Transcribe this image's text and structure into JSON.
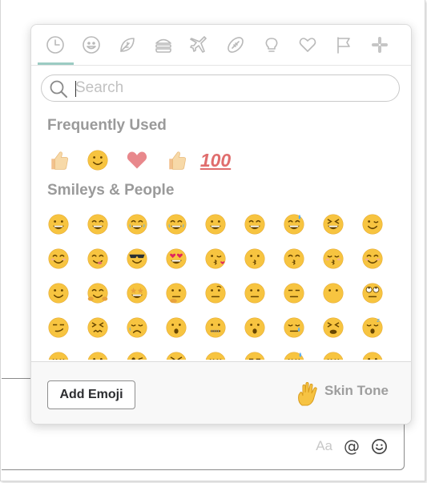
{
  "categories": [
    {
      "name": "recent-icon",
      "active": true
    },
    {
      "name": "smileys-icon"
    },
    {
      "name": "nature-icon"
    },
    {
      "name": "food-icon"
    },
    {
      "name": "travel-icon"
    },
    {
      "name": "activity-icon"
    },
    {
      "name": "objects-icon"
    },
    {
      "name": "symbols-icon"
    },
    {
      "name": "flags-icon"
    },
    {
      "name": "slack-icon"
    }
  ],
  "search": {
    "placeholder": "Search",
    "value": ""
  },
  "frequently_used": {
    "title": "Frequently Used",
    "items": [
      "thumbsup-light",
      "slight-smile",
      "heart",
      "thumbsup-light",
      "100"
    ],
    "hundred_text": "100"
  },
  "smileys": {
    "title": "Smileys & People",
    "rows": [
      [
        "grinning",
        "grin",
        "joy",
        "rofl",
        "smiley",
        "smile",
        "sweat-smile",
        "laughing",
        "wink"
      ],
      [
        "blush",
        "yum",
        "sunglasses",
        "heart-eyes",
        "kissing-heart",
        "kissing",
        "kissing-smiling",
        "kissing-closed",
        "relaxed"
      ],
      [
        "slight-smile",
        "hugging",
        "star-struck",
        "thinking",
        "raised-eyebrow",
        "neutral",
        "expressionless",
        "no-mouth",
        "eye-roll"
      ],
      [
        "smirk",
        "persevere",
        "disappointed-relieved",
        "open-mouth",
        "zipper",
        "hushed",
        "sleepy",
        "tired",
        "sleeping"
      ],
      [
        "relieved",
        "stuck-out-tongue",
        "stuck-out-tongue-wink",
        "stuck-out-tongue-closed",
        "drooling",
        "unamused",
        "sweat",
        "pensive",
        "confused"
      ]
    ]
  },
  "footer": {
    "add_emoji_label": "Add Emoji",
    "skin_tone_label": "Skin Tone"
  },
  "composer": {
    "aa_label": "Aa",
    "at_symbol": "@"
  },
  "colors": {
    "accent": "#9ccbc3",
    "face": "#f7c440",
    "heart": "#e8888c",
    "thumb": "#f7d9a8"
  }
}
